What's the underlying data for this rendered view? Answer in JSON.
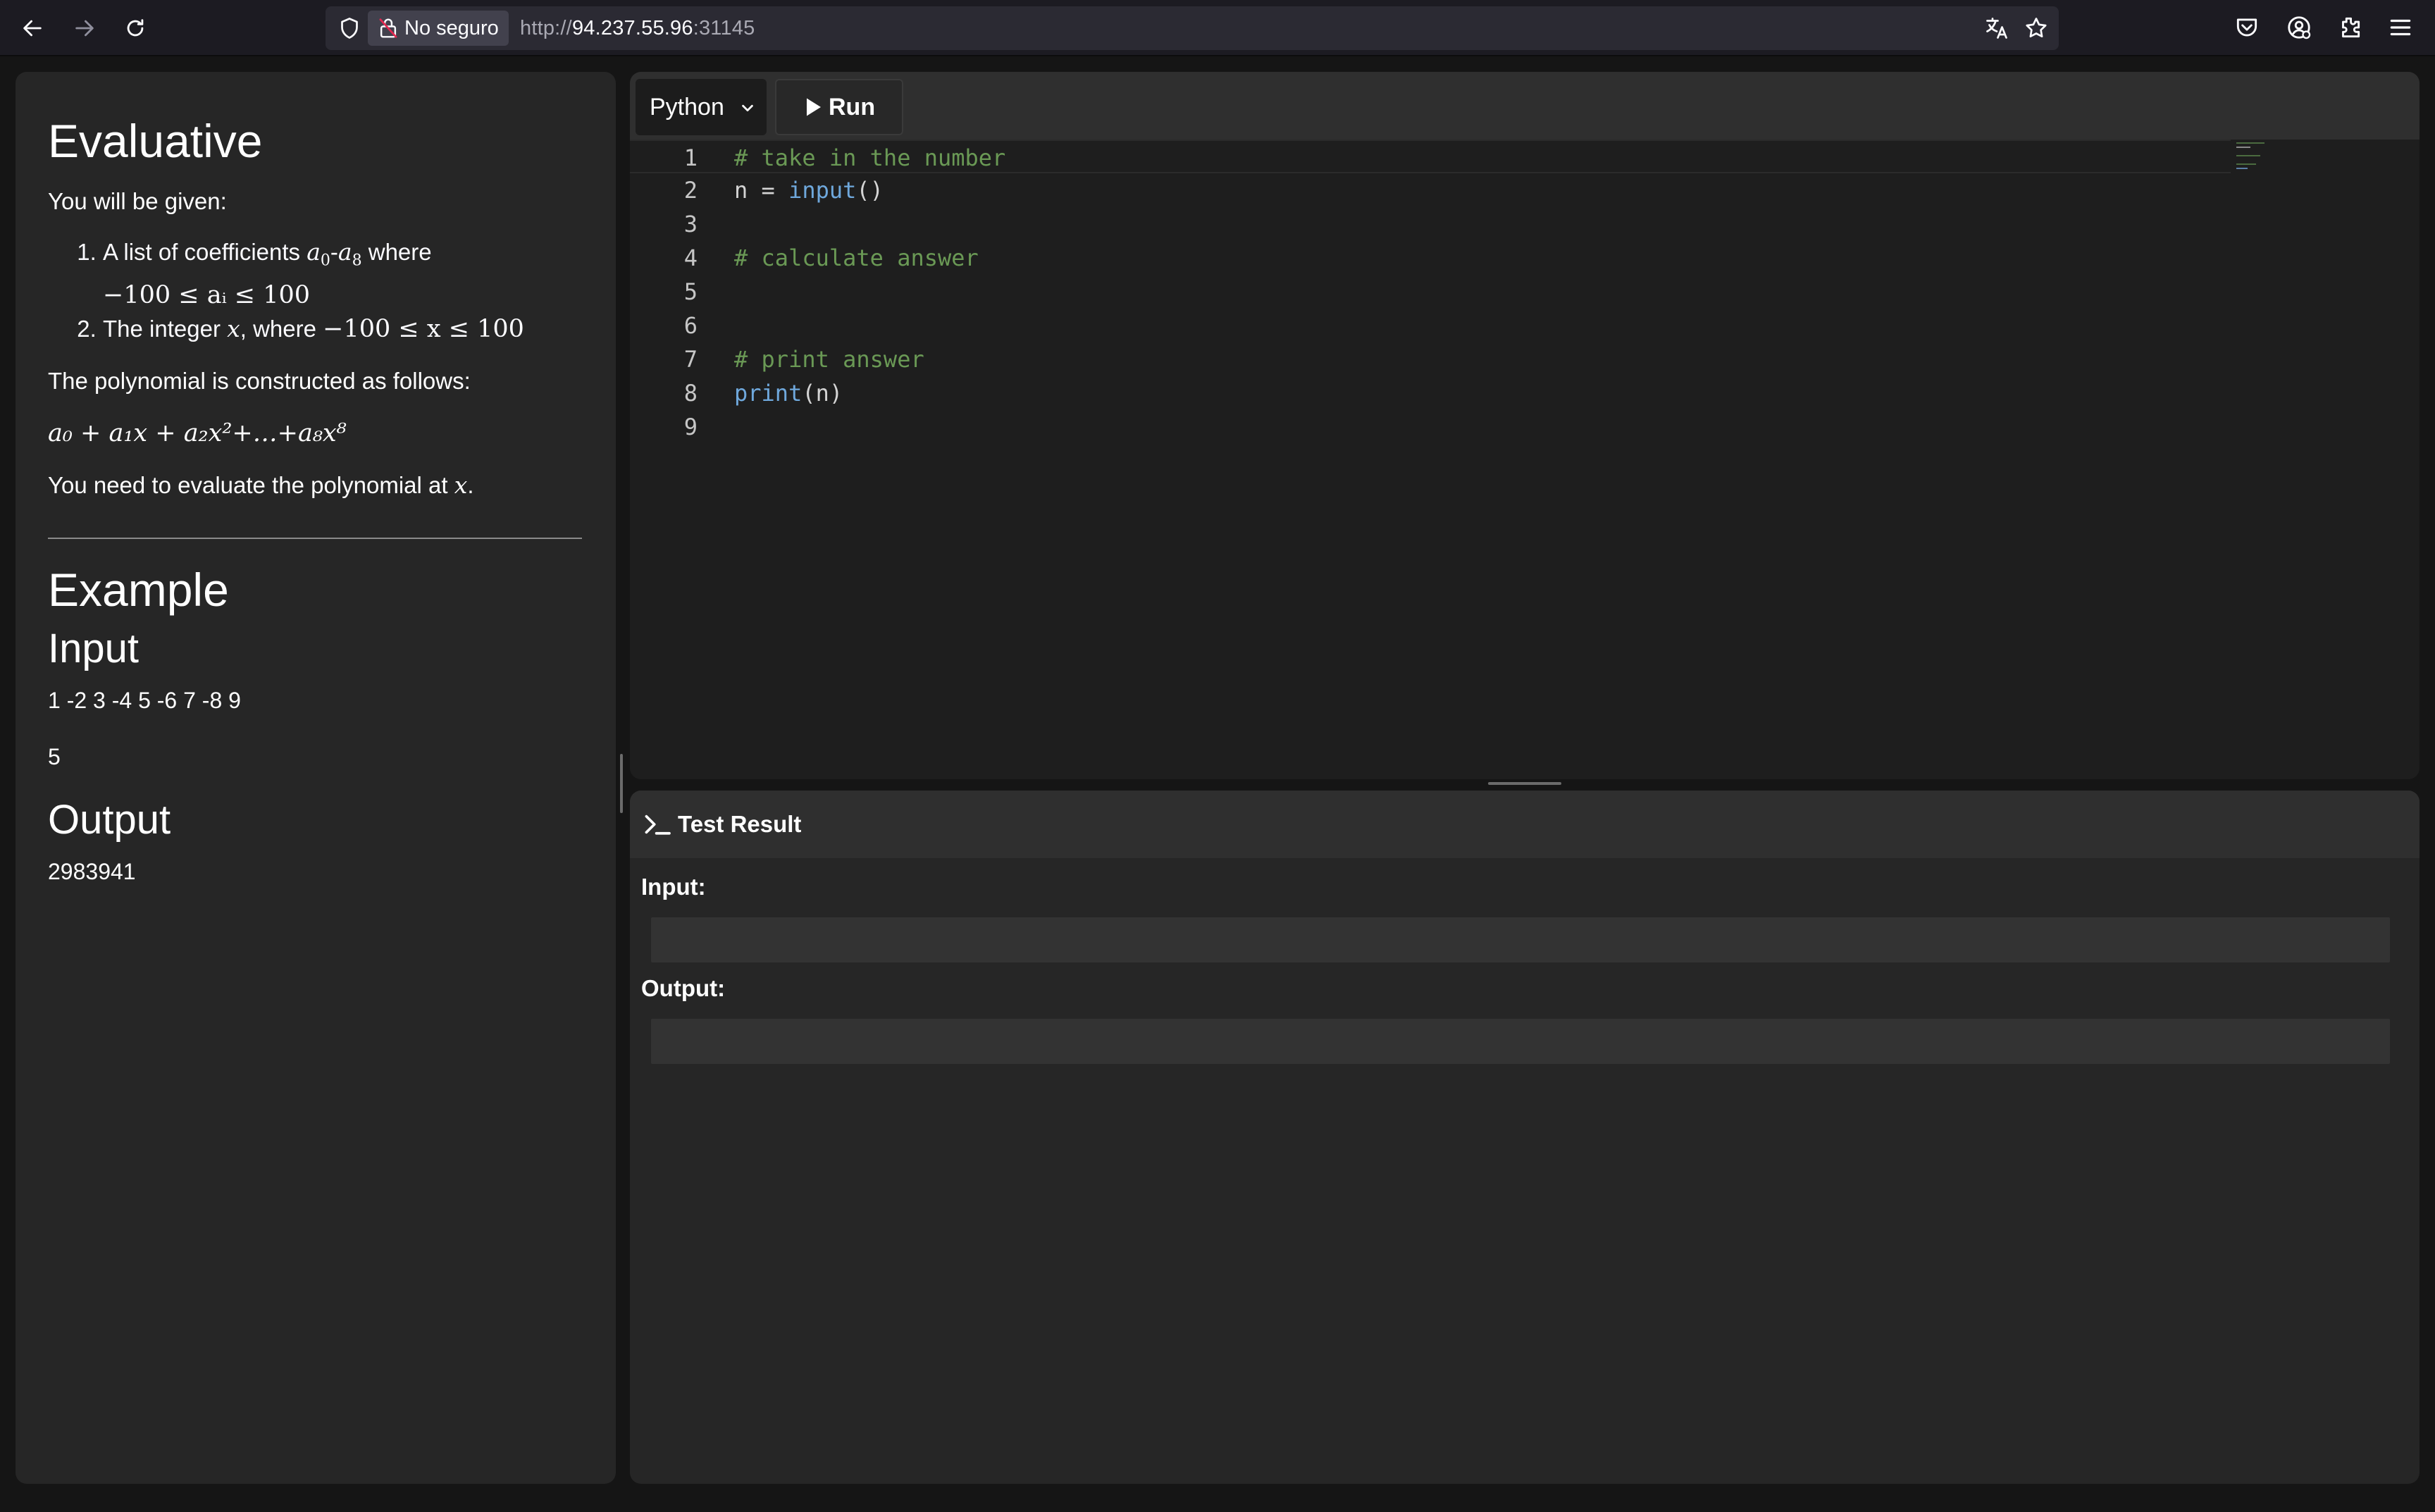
{
  "browser": {
    "security_label": "No seguro",
    "url_prefix": "http://",
    "url_host": "94.237.55.96",
    "url_port": ":31145"
  },
  "problem": {
    "title": "Evaluative",
    "intro": "You will be given:",
    "given": [
      {
        "text_before": "A list of coefficients ",
        "math1": "a",
        "sub1": "0",
        "dash": "-",
        "math2": "a",
        "sub2": "8",
        "text_after": " where",
        "constraint": "−100 ≤ aᵢ ≤ 100"
      },
      {
        "text_before": "The integer ",
        "math1": "x",
        "text_after": ", where ",
        "constraint": "−100 ≤ x ≤ 100"
      }
    ],
    "construction": "The polynomial is constructed as follows:",
    "formula": "a₀ + a₁x + a₂x²+…+a₈x⁸",
    "task": "You need to evaluate the polynomial at ",
    "task_var": "x",
    "task_end": "."
  },
  "example": {
    "title": "Example",
    "input_heading": "Input",
    "input_line1": "1 -2 3 -4 5 -6 7 -8 9",
    "input_line2": "5",
    "output_heading": "Output",
    "output_value": "2983941"
  },
  "editor": {
    "language": "Python",
    "run_label": "Run",
    "lines": [
      {
        "num": "1",
        "code": "# take in the number"
      },
      {
        "num": "2",
        "code": "n = input()"
      },
      {
        "num": "3",
        "code": ""
      },
      {
        "num": "4",
        "code": "# calculate answer"
      },
      {
        "num": "5",
        "code": ""
      },
      {
        "num": "6",
        "code": ""
      },
      {
        "num": "7",
        "code": "# print answer"
      },
      {
        "num": "8",
        "code": "print(n)"
      },
      {
        "num": "9",
        "code": ""
      }
    ]
  },
  "result": {
    "title": "Test Result",
    "input_label": "Input:",
    "input_value": "",
    "output_label": "Output:",
    "output_value": ""
  }
}
